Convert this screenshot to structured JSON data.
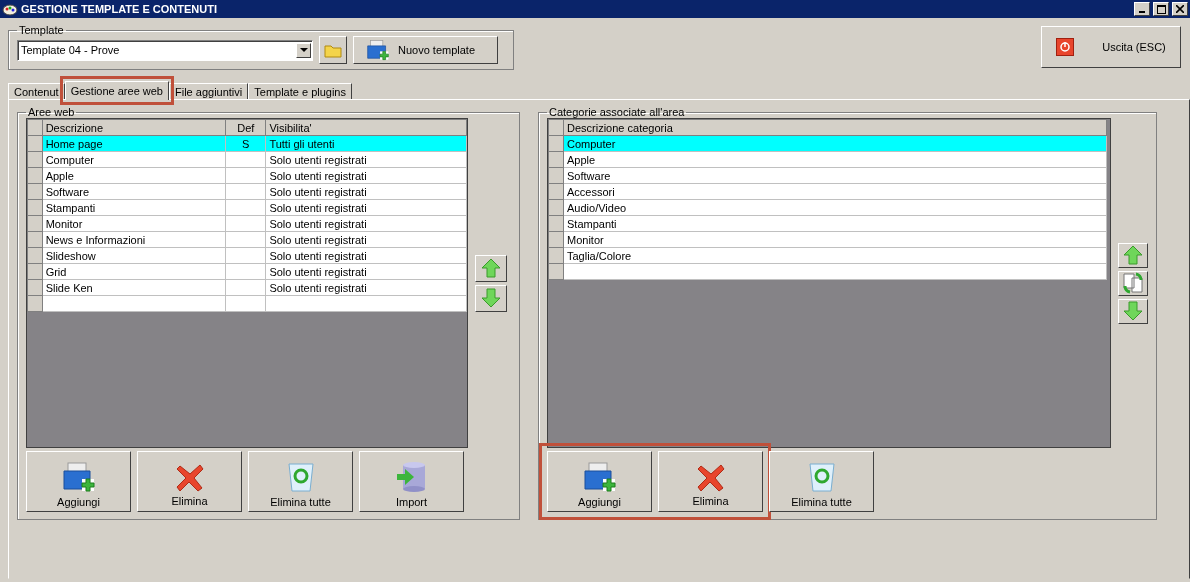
{
  "window": {
    "title": "GESTIONE TEMPLATE E CONTENUTI"
  },
  "template": {
    "legend": "Template",
    "value": "Template 04 - Prove",
    "new_button": "Nuovo template"
  },
  "exit_button": "Uscita (ESC)",
  "tabs": [
    {
      "label": "Contenut",
      "selected": false,
      "highlighted": false
    },
    {
      "label": "Gestione aree web",
      "selected": true,
      "highlighted": true
    },
    {
      "label": "File aggiuntivi",
      "selected": false,
      "highlighted": false
    },
    {
      "label": "Template e plugins",
      "selected": false,
      "highlighted": false
    }
  ],
  "areas": {
    "legend": "Aree web",
    "columns": [
      "Descrizione",
      "Def",
      "Visibilita'"
    ],
    "rows": [
      {
        "cells": [
          "Home page",
          "S",
          "Tutti gli utenti"
        ],
        "selected": true
      },
      {
        "cells": [
          "Computer",
          "",
          "Solo utenti registrati"
        ],
        "selected": false
      },
      {
        "cells": [
          "Apple",
          "",
          "Solo utenti registrati"
        ],
        "selected": false
      },
      {
        "cells": [
          "Software",
          "",
          "Solo utenti registrati"
        ],
        "selected": false
      },
      {
        "cells": [
          "Stampanti",
          "",
          "Solo utenti registrati"
        ],
        "selected": false
      },
      {
        "cells": [
          "Monitor",
          "",
          "Solo utenti registrati"
        ],
        "selected": false
      },
      {
        "cells": [
          "News e Informazioni",
          "",
          "Solo utenti registrati"
        ],
        "selected": false
      },
      {
        "cells": [
          "Slideshow",
          "",
          "Solo utenti registrati"
        ],
        "selected": false
      },
      {
        "cells": [
          "Grid",
          "",
          "Solo utenti registrati"
        ],
        "selected": false
      },
      {
        "cells": [
          "Slide Ken",
          "",
          "Solo utenti registrati"
        ],
        "selected": false
      }
    ],
    "side_buttons": [
      {
        "kind": "up"
      },
      {
        "kind": "down"
      }
    ],
    "buttons": [
      {
        "kind": "add",
        "label": "Aggiungi",
        "highlighted": false
      },
      {
        "kind": "delete",
        "label": "Elimina",
        "highlighted": false
      },
      {
        "kind": "trash",
        "label": "Elimina tutte",
        "highlighted": false
      },
      {
        "kind": "import",
        "label": "Import",
        "highlighted": false
      }
    ]
  },
  "categories": {
    "legend": "Categorie associate all'area",
    "columns": [
      "Descrizione categoria"
    ],
    "rows": [
      {
        "cells": [
          "Computer"
        ],
        "selected": true
      },
      {
        "cells": [
          "Apple"
        ],
        "selected": false
      },
      {
        "cells": [
          "Software"
        ],
        "selected": false
      },
      {
        "cells": [
          "Accessori"
        ],
        "selected": false
      },
      {
        "cells": [
          "Audio/Video"
        ],
        "selected": false
      },
      {
        "cells": [
          "Stampanti"
        ],
        "selected": false
      },
      {
        "cells": [
          "Monitor"
        ],
        "selected": false
      },
      {
        "cells": [
          "Taglia/Colore"
        ],
        "selected": false
      }
    ],
    "side_buttons": [
      {
        "kind": "up"
      },
      {
        "kind": "swap"
      },
      {
        "kind": "down"
      }
    ],
    "buttons": [
      {
        "kind": "add",
        "label": "Aggiungi",
        "highlighted": true
      },
      {
        "kind": "delete",
        "label": "Elimina",
        "highlighted": true
      },
      {
        "kind": "trash",
        "label": "Elimina tutte",
        "highlighted": false
      }
    ]
  }
}
